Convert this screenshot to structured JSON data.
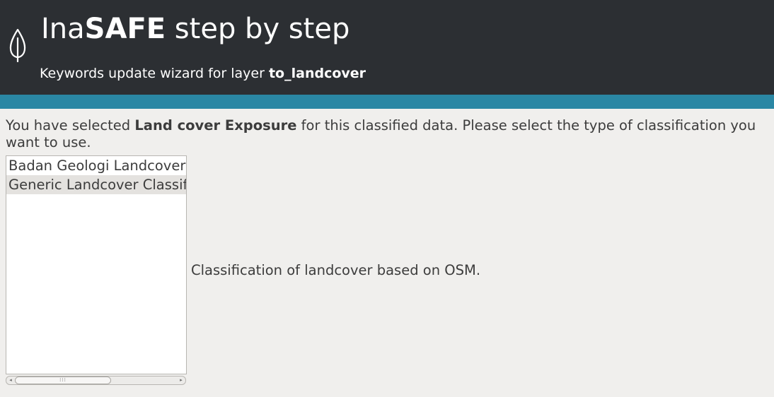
{
  "header": {
    "title_prefix": "Ina",
    "title_bold": "SAFE",
    "title_suffix": " step by step",
    "subtitle_prefix": "Keywords update wizard for layer ",
    "subtitle_layer": "to_landcover",
    "logo_icon": "inasafe-leaf-icon",
    "background_color": "#2c2f33",
    "stripe_color": "#2a87a4"
  },
  "instruction": {
    "prefix": "You have selected ",
    "bold": "Land cover Exposure",
    "suffix": " for this classified data. Please select the type of classification you want to use."
  },
  "classifications": {
    "items": [
      {
        "label": "Badan Geologi Landcover"
      },
      {
        "label": "Generic Landcover Classification"
      }
    ],
    "selected_index": 1
  },
  "scrollbar": {
    "left_arrow": "◂",
    "right_arrow": "▸",
    "thumb_grip": "⁞⁞⁞"
  },
  "description": "Classification of landcover based on OSM."
}
